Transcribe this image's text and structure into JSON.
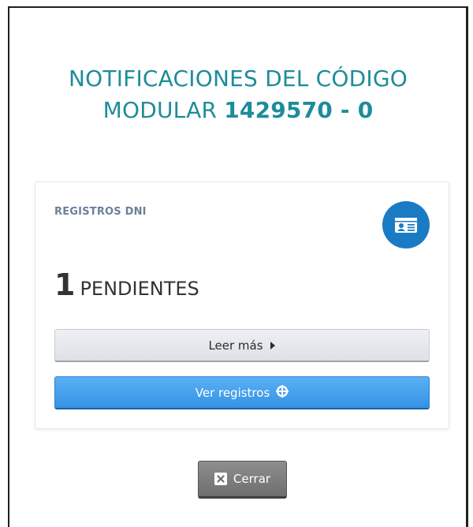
{
  "modal": {
    "title_line1": "NOTIFICACIONES DEL CÓDIGO",
    "title_prefix": "MODULAR ",
    "title_code": "1429570 - 0"
  },
  "card": {
    "label": "REGISTROS DNI",
    "icon": "id-card-icon",
    "count": "1",
    "count_unit": "PENDIENTES",
    "read_more_label": "Leer más",
    "read_more_icon": "caret-right-icon",
    "view_label": "Ver registros",
    "view_icon": "crosshair-icon"
  },
  "footer": {
    "close_label": "Cerrar",
    "close_icon": "close-icon"
  },
  "colors": {
    "title": "#1e8c9a",
    "icon_circle": "#1a7bc5",
    "primary_button": "#3592e4",
    "close_button": "#7a7a7a"
  }
}
